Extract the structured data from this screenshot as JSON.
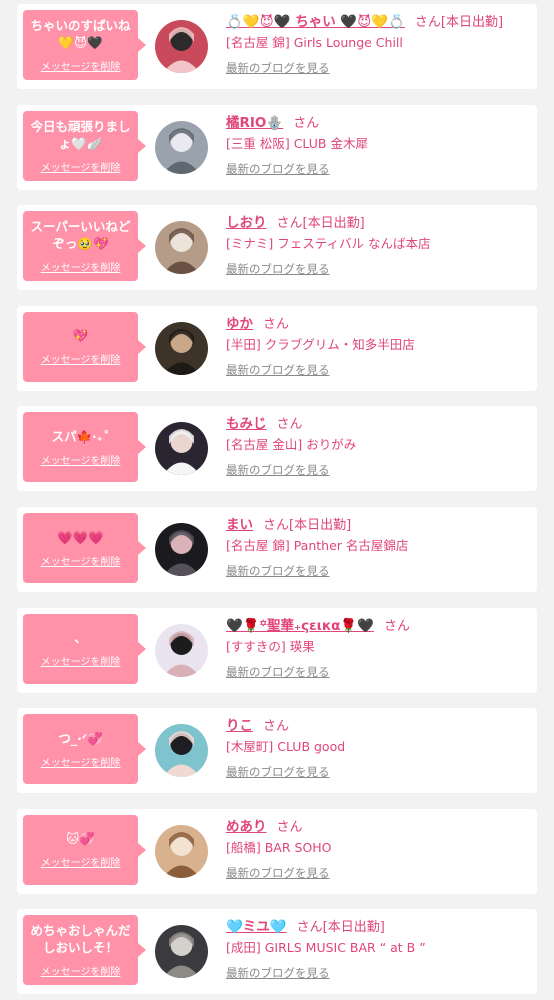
{
  "delete_label": "メッセージを削除",
  "san_label": "さん",
  "blog_label": "最新のブログを見る",
  "colors": {
    "page_bg": "#f2f2f2",
    "card_bg": "#ffffff",
    "bubble": "#ff91a8",
    "accent": "#e0457b",
    "link_gray": "#8a8a8a"
  },
  "items": [
    {
      "message": "ちゃいのすぱいね💛😈🖤",
      "name": "💍💛😈🖤 ちゃい 🖤😈💛💍",
      "status": "[本日出勤]",
      "shop": "[名古屋 錦] Girls Lounge Chill",
      "avatar_palette": [
        "#c94a5a",
        "#2b2b2b",
        "#f2c6c8"
      ]
    },
    {
      "message": "今日も頑張りましょ🤍🪽",
      "name": "橘RIO🪬",
      "status": "",
      "shop": "[三重 松阪] CLUB 金木犀",
      "avatar_palette": [
        "#9aa3ad",
        "#e9e9ef",
        "#5f6770"
      ]
    },
    {
      "message": "スーパーいいねどぞっ🥹💖",
      "name": "しおり",
      "status": "[本日出勤]",
      "shop": "[ミナミ] フェスティバル なんば本店",
      "avatar_palette": [
        "#b59c88",
        "#ece3da",
        "#6b5143"
      ]
    },
    {
      "message": "💖",
      "name": "ゆか",
      "status": "",
      "shop": "[半田] クラブグリム・知多半田店",
      "avatar_palette": [
        "#3d3328",
        "#c9a78a",
        "#1e1a15"
      ]
    },
    {
      "message": "スパ🍁‧₊˚",
      "name": "もみじ",
      "status": "",
      "shop": "[名古屋 金山] おりがみ",
      "avatar_palette": [
        "#2a2530",
        "#e8d6cf",
        "#f5f5f5"
      ]
    },
    {
      "message": "💗💗💗",
      "name": "まい",
      "status": "[本日出勤]",
      "shop": "[名古屋 錦] Panther 名古屋錦店",
      "avatar_palette": [
        "#1a1a1f",
        "#d9b3b8",
        "#55505a"
      ]
    },
    {
      "message": "、",
      "name": "🖤🌹꙳聖華₊ςειкα🌹🖤",
      "status": "",
      "shop": "[すすきの] 瑛果",
      "avatar_palette": [
        "#e9e4f0",
        "#1c1c1c",
        "#d8b0b5"
      ]
    },
    {
      "message": "つ_·ᐟ💞",
      "name": "りこ",
      "status": "",
      "shop": "[木屋町] CLUB good",
      "avatar_palette": [
        "#7fc3cf",
        "#1d1d22",
        "#f1d9d3"
      ]
    },
    {
      "message": "🐱💞",
      "name": "めあり",
      "status": "",
      "shop": "[船橋] BAR SOHO",
      "avatar_palette": [
        "#d8b28e",
        "#f3e2cf",
        "#8a5d3b"
      ]
    },
    {
      "message": "めちゃおしゃんだしおいしそ！",
      "name": "🩵ミユ🩵",
      "status": "[本日出勤]",
      "shop": "[成田] GIRLS MUSIC BAR “ at B ”",
      "avatar_palette": [
        "#3a3a3f",
        "#d4d0cc",
        "#8e8a86"
      ]
    }
  ]
}
